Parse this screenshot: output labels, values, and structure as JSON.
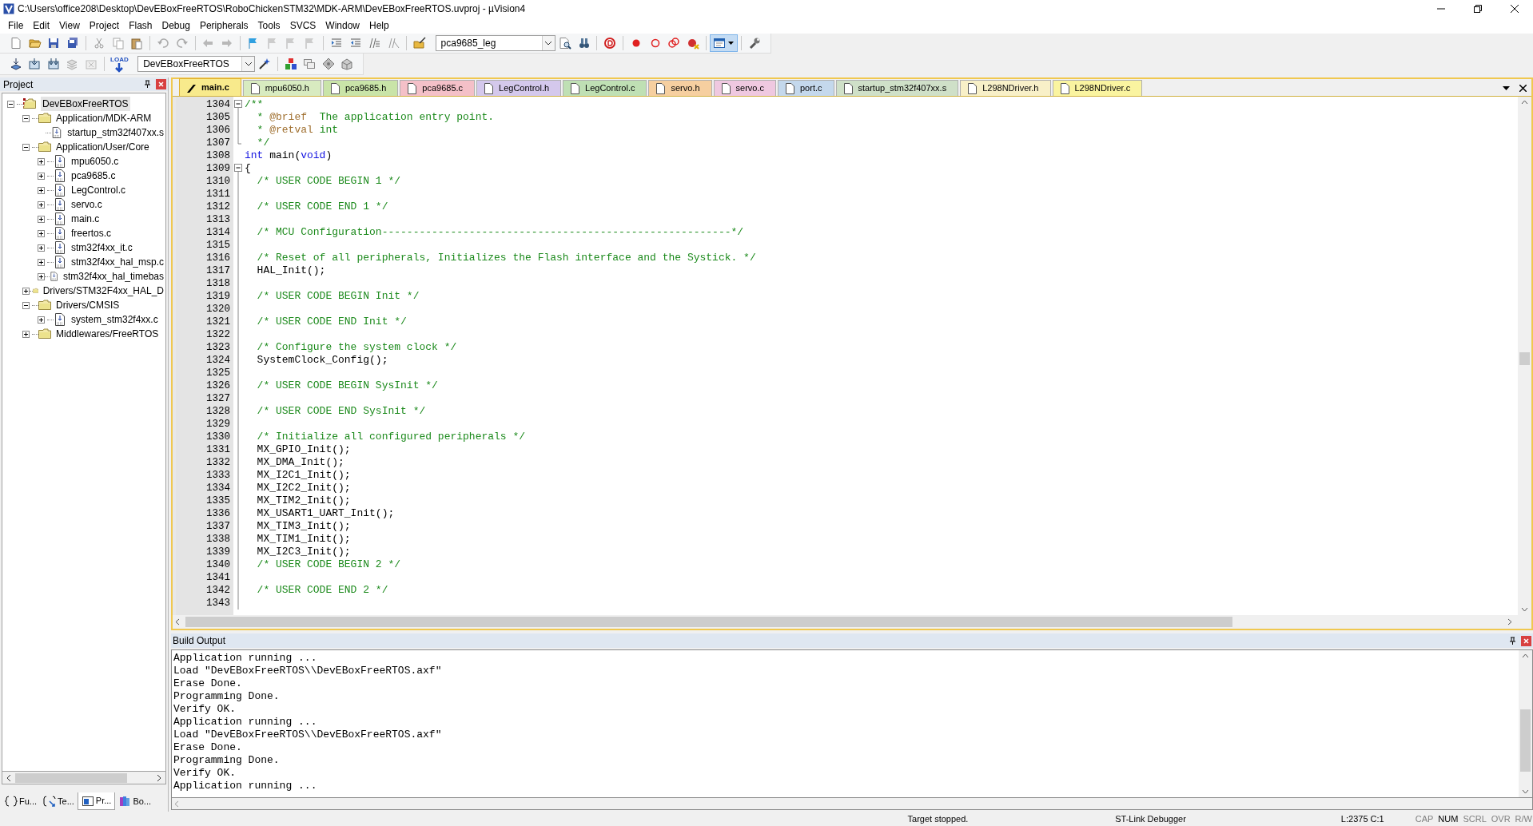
{
  "window": {
    "title": "C:\\Users\\office208\\Desktop\\DevEBoxFreeRTOS\\RoboChickenSTM32\\MDK-ARM\\DevEBoxFreeRTOS.uvproj - µVision4"
  },
  "menu": [
    "File",
    "Edit",
    "View",
    "Project",
    "Flash",
    "Debug",
    "Peripherals",
    "Tools",
    "SVCS",
    "Window",
    "Help"
  ],
  "toolbar": {
    "find_combo": "pca9685_leg",
    "target_combo": "DevEBoxFreeRTOS",
    "load_label": "LOAD"
  },
  "project_panel": {
    "title": "Project",
    "tree": [
      {
        "label": "DevEBoxFreeRTOS",
        "kind": "project",
        "expanded": true,
        "selected": true,
        "children": [
          {
            "label": "Application/MDK-ARM",
            "kind": "group",
            "expanded": true,
            "selected": false,
            "children": [
              {
                "label": "startup_stm32f407xx.s",
                "kind": "leaf",
                "selected": false
              }
            ]
          },
          {
            "label": "Application/User/Core",
            "kind": "group",
            "expanded": true,
            "selected": false,
            "children": [
              {
                "label": "mpu6050.c",
                "kind": "file",
                "expanded": false,
                "selected": false
              },
              {
                "label": "pca9685.c",
                "kind": "file",
                "expanded": false,
                "selected": false
              },
              {
                "label": "LegControl.c",
                "kind": "file",
                "expanded": false,
                "selected": false
              },
              {
                "label": "servo.c",
                "kind": "file",
                "expanded": false,
                "selected": false
              },
              {
                "label": "main.c",
                "kind": "file",
                "expanded": false,
                "selected": false
              },
              {
                "label": "freertos.c",
                "kind": "file",
                "expanded": false,
                "selected": false
              },
              {
                "label": "stm32f4xx_it.c",
                "kind": "file",
                "expanded": false,
                "selected": false
              },
              {
                "label": "stm32f4xx_hal_msp.c",
                "kind": "file",
                "expanded": false,
                "selected": false
              },
              {
                "label": "stm32f4xx_hal_timebas",
                "kind": "file",
                "expanded": false,
                "selected": false
              }
            ]
          },
          {
            "label": "Drivers/STM32F4xx_HAL_D",
            "kind": "group",
            "expanded": false,
            "selected": false
          },
          {
            "label": "Drivers/CMSIS",
            "kind": "group",
            "expanded": true,
            "selected": false,
            "children": [
              {
                "label": "system_stm32f4xx.c",
                "kind": "file",
                "expanded": false,
                "selected": false
              }
            ]
          },
          {
            "label": "Middlewares/FreeRTOS",
            "kind": "group",
            "expanded": false,
            "selected": false
          }
        ]
      }
    ],
    "bottom_tabs": [
      {
        "label": "Fu...",
        "kind": "braces",
        "selected": false
      },
      {
        "label": "Te...",
        "kind": "template",
        "selected": false
      },
      {
        "label": "Pr...",
        "kind": "project",
        "selected": true
      },
      {
        "label": "Bo...",
        "kind": "books",
        "selected": false
      }
    ]
  },
  "editor_tabs": [
    {
      "label": "main.c",
      "color": "#f8ea8c",
      "selected": true
    },
    {
      "label": "mpu6050.h",
      "color": "#d8ebc0",
      "selected": false
    },
    {
      "label": "pca9685.h",
      "color": "#c9e4a8",
      "selected": false
    },
    {
      "label": "pca9685.c",
      "color": "#f4c0c8",
      "selected": false
    },
    {
      "label": "LegControl.h",
      "color": "#d4c8ec",
      "selected": false
    },
    {
      "label": "LegControl.c",
      "color": "#bfe0b4",
      "selected": false
    },
    {
      "label": "servo.h",
      "color": "#f6cfa0",
      "selected": false
    },
    {
      "label": "servo.c",
      "color": "#efc8e0",
      "selected": false
    },
    {
      "label": "port.c",
      "color": "#c4d8ec",
      "selected": false
    },
    {
      "label": "startup_stm32f407xx.s",
      "color": "#cfe0c8",
      "selected": false
    },
    {
      "label": "L298NDriver.h",
      "color": "#f8f0c8",
      "selected": false
    },
    {
      "label": "L298NDriver.c",
      "color": "#faf4a0",
      "selected": false
    }
  ],
  "code_lines": [
    {
      "num": "1304",
      "fold": {
        "kind": "start"
      },
      "parts": [
        {
          "text": "/**",
          "kind": "comment"
        }
      ]
    },
    {
      "num": "1305",
      "fold": {
        "kind": "inner"
      },
      "parts": [
        {
          "text": "  * ",
          "kind": "comment"
        },
        {
          "text": "@brief",
          "kind": "doctag"
        },
        {
          "text": "  The application entry point.",
          "kind": "comment"
        }
      ]
    },
    {
      "num": "1306",
      "fold": {
        "kind": "inner"
      },
      "parts": [
        {
          "text": "  * ",
          "kind": "comment"
        },
        {
          "text": "@retval",
          "kind": "doctag"
        },
        {
          "text": " int",
          "kind": "comment"
        }
      ]
    },
    {
      "num": "1307",
      "fold": {
        "kind": "end"
      },
      "parts": [
        {
          "text": "  */",
          "kind": "comment"
        }
      ]
    },
    {
      "num": "1308",
      "parts": [
        {
          "text": "int",
          "kind": "keyword"
        },
        {
          "text": " main(",
          "kind": "plain"
        },
        {
          "text": "void",
          "kind": "keyword"
        },
        {
          "text": ")",
          "kind": "plain"
        }
      ]
    },
    {
      "num": "1309",
      "fold": {
        "kind": "start"
      },
      "parts": [
        {
          "text": "{",
          "kind": "plain"
        }
      ]
    },
    {
      "num": "1310",
      "fold": {
        "kind": "inner"
      },
      "parts": [
        {
          "text": "  /* USER CODE BEGIN 1 */",
          "kind": "comment"
        }
      ]
    },
    {
      "num": "1311",
      "fold": {
        "kind": "inner"
      }
    },
    {
      "num": "1312",
      "fold": {
        "kind": "inner"
      },
      "parts": [
        {
          "text": "  /* USER CODE END 1 */",
          "kind": "comment"
        }
      ]
    },
    {
      "num": "1313",
      "fold": {
        "kind": "inner"
      }
    },
    {
      "num": "1314",
      "fold": {
        "kind": "inner"
      },
      "parts": [
        {
          "text": "  /* MCU Configuration--------------------------------------------------------*/",
          "kind": "comment"
        }
      ]
    },
    {
      "num": "1315",
      "fold": {
        "kind": "inner"
      }
    },
    {
      "num": "1316",
      "fold": {
        "kind": "inner"
      },
      "parts": [
        {
          "text": "  /* Reset of all peripherals, Initializes the Flash interface and the Systick. */",
          "kind": "comment"
        }
      ]
    },
    {
      "num": "1317",
      "fold": {
        "kind": "inner"
      },
      "parts": [
        {
          "text": "  HAL_Init();",
          "kind": "plain"
        }
      ]
    },
    {
      "num": "1318",
      "fold": {
        "kind": "inner"
      }
    },
    {
      "num": "1319",
      "fold": {
        "kind": "inner"
      },
      "parts": [
        {
          "text": "  /* USER CODE BEGIN Init */",
          "kind": "comment"
        }
      ]
    },
    {
      "num": "1320",
      "fold": {
        "kind": "inner"
      }
    },
    {
      "num": "1321",
      "fold": {
        "kind": "inner"
      },
      "parts": [
        {
          "text": "  /* USER CODE END Init */",
          "kind": "comment"
        }
      ]
    },
    {
      "num": "1322",
      "fold": {
        "kind": "inner"
      }
    },
    {
      "num": "1323",
      "fold": {
        "kind": "inner"
      },
      "parts": [
        {
          "text": "  /* Configure the system clock */",
          "kind": "comment"
        }
      ]
    },
    {
      "num": "1324",
      "fold": {
        "kind": "inner"
      },
      "parts": [
        {
          "text": "  SystemClock_Config();",
          "kind": "plain"
        }
      ]
    },
    {
      "num": "1325",
      "fold": {
        "kind": "inner"
      }
    },
    {
      "num": "1326",
      "fold": {
        "kind": "inner"
      },
      "parts": [
        {
          "text": "  /* USER CODE BEGIN SysInit */",
          "kind": "comment"
        }
      ]
    },
    {
      "num": "1327",
      "fold": {
        "kind": "inner"
      }
    },
    {
      "num": "1328",
      "fold": {
        "kind": "inner"
      },
      "parts": [
        {
          "text": "  /* USER CODE END SysInit */",
          "kind": "comment"
        }
      ]
    },
    {
      "num": "1329",
      "fold": {
        "kind": "inner"
      }
    },
    {
      "num": "1330",
      "fold": {
        "kind": "inner"
      },
      "parts": [
        {
          "text": "  /* Initialize all configured peripherals */",
          "kind": "comment"
        }
      ]
    },
    {
      "num": "1331",
      "fold": {
        "kind": "inner"
      },
      "parts": [
        {
          "text": "  MX_GPIO_Init();",
          "kind": "plain"
        }
      ]
    },
    {
      "num": "1332",
      "fold": {
        "kind": "inner"
      },
      "parts": [
        {
          "text": "  MX_DMA_Init();",
          "kind": "plain"
        }
      ]
    },
    {
      "num": "1333",
      "fold": {
        "kind": "inner"
      },
      "parts": [
        {
          "text": "  MX_I2C1_Init();",
          "kind": "plain"
        }
      ]
    },
    {
      "num": "1334",
      "fold": {
        "kind": "inner"
      },
      "parts": [
        {
          "text": "  MX_I2C2_Init();",
          "kind": "plain"
        }
      ]
    },
    {
      "num": "1335",
      "fold": {
        "kind": "inner"
      },
      "parts": [
        {
          "text": "  MX_TIM2_Init();",
          "kind": "plain"
        }
      ]
    },
    {
      "num": "1336",
      "fold": {
        "kind": "inner"
      },
      "parts": [
        {
          "text": "  MX_USART1_UART_Init();",
          "kind": "plain"
        }
      ]
    },
    {
      "num": "1337",
      "fold": {
        "kind": "inner"
      },
      "parts": [
        {
          "text": "  MX_TIM3_Init();",
          "kind": "plain"
        }
      ]
    },
    {
      "num": "1338",
      "fold": {
        "kind": "inner"
      },
      "parts": [
        {
          "text": "  MX_TIM1_Init();",
          "kind": "plain"
        }
      ]
    },
    {
      "num": "1339",
      "fold": {
        "kind": "inner"
      },
      "parts": [
        {
          "text": "  MX_I2C3_Init();",
          "kind": "plain"
        }
      ]
    },
    {
      "num": "1340",
      "fold": {
        "kind": "inner"
      },
      "parts": [
        {
          "text": "  /* USER CODE BEGIN 2 */",
          "kind": "comment"
        }
      ]
    },
    {
      "num": "1341",
      "fold": {
        "kind": "inner"
      }
    },
    {
      "num": "1342",
      "fold": {
        "kind": "inner"
      },
      "parts": [
        {
          "text": "  /* USER CODE END 2 */",
          "kind": "comment"
        }
      ]
    },
    {
      "num": "1343",
      "fold": {
        "kind": "inner"
      }
    }
  ],
  "build_output": {
    "title": "Build Output",
    "lines": [
      "Application running ...",
      "Load \"DevEBoxFreeRTOS\\\\DevEBoxFreeRTOS.axf\"",
      "Erase Done.",
      "Programming Done.",
      "Verify OK.",
      "Application running ...",
      "Load \"DevEBoxFreeRTOS\\\\DevEBoxFreeRTOS.axf\"",
      "Erase Done.",
      "Programming Done.",
      "Verify OK.",
      "Application running ..."
    ]
  },
  "status_bar": {
    "state": "Target stopped.",
    "debugger": "ST-Link Debugger",
    "position": "L:2375 C:1",
    "indicators": [
      "CAP",
      "NUM",
      "SCRL",
      "OVR",
      "R/W"
    ]
  }
}
